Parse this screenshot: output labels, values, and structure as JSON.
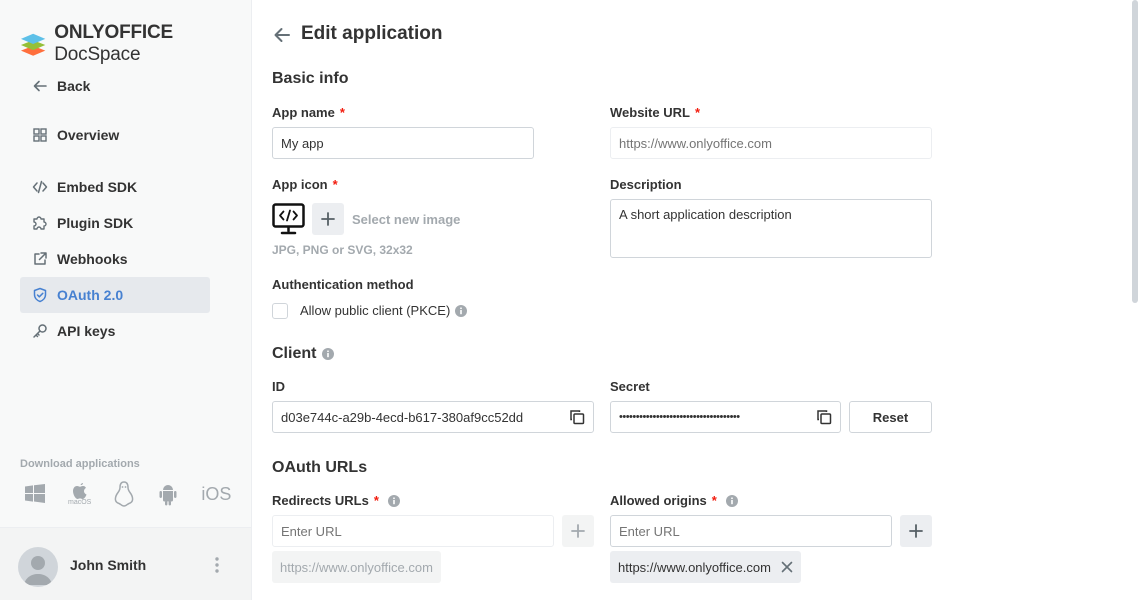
{
  "logo": {
    "brand": "ONLYOFFICE",
    "product": " DocSpace"
  },
  "nav": {
    "back": "Back",
    "overview": "Overview",
    "embed_sdk": "Embed SDK",
    "plugin_sdk": "Plugin SDK",
    "webhooks": "Webhooks",
    "oauth": "OAuth 2.0",
    "api_keys": "API keys"
  },
  "download": {
    "label": "Download applications",
    "macos_sub": "macOS",
    "ios": "iOS"
  },
  "profile": {
    "name": "John Smith"
  },
  "page": {
    "title": "Edit application"
  },
  "basic_info": {
    "title": "Basic info",
    "app_name_label": "App name",
    "app_name_value": "My app",
    "website_label": "Website URL",
    "website_placeholder": "https://www.onlyoffice.com",
    "app_icon_label": "App icon",
    "select_image": "Select new image",
    "icon_hint": "JPG, PNG or SVG, 32x32",
    "description_label": "Description",
    "description_value": "A short application description",
    "auth_method_label": "Authentication method",
    "pkce_label": "Allow public client (PKCE)"
  },
  "client": {
    "title": "Client",
    "id_label": "ID",
    "id_value": "d03e744c-a29b-4ecd-b617-380af9cc52dd",
    "secret_label": "Secret",
    "secret_value": "••••••••••••••••••••••••••••••••••••",
    "reset_label": "Reset"
  },
  "oauth_urls": {
    "title": "OAuth URLs",
    "redirects_label": "Redirects URLs",
    "redirects_placeholder": "Enter URL",
    "redirects_chip": "https://www.onlyoffice.com",
    "origins_label": "Allowed origins",
    "origins_placeholder": "Enter URL",
    "origins_chip": "https://www.onlyoffice.com"
  },
  "colors": {
    "accent": "#4781d1",
    "required": "#f21c0e",
    "muted": "#a3a9ae"
  }
}
